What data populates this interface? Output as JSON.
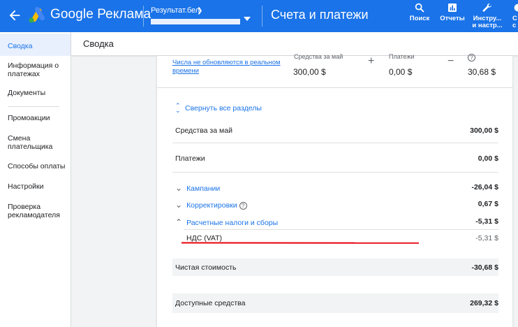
{
  "app": {
    "brand": "Google Реклама",
    "account_name": "Результат.бел",
    "page_heading": "Счета и платежи"
  },
  "toolbar": [
    {
      "label": "Поиск"
    },
    {
      "label": "Отчеты"
    },
    {
      "label_line1": "Инстру...",
      "label_line2": "и настр..."
    },
    {
      "label_line1": "С",
      "label_line2": "с"
    }
  ],
  "sidebar": {
    "items": [
      {
        "label": "Сводка",
        "active": true
      },
      {
        "label": "Информация о платежах"
      },
      {
        "label": "Документы"
      },
      {
        "label": "Промоакции"
      },
      {
        "label": "Смена плательщика"
      },
      {
        "label": "Способы оплаты"
      },
      {
        "label": "Настройки"
      },
      {
        "label": "Проверка рекламодателя"
      }
    ]
  },
  "main": {
    "title": "Сводка",
    "summary": {
      "realtime_note": "Числа не обновляются в реальном времени",
      "col1_label": "Средства за май",
      "col1_value": "300,00 $",
      "col2_label": "Платежи",
      "col2_value": "0,00 $",
      "col3_value": "30,68 $",
      "op_plus": "+",
      "op_minus": "−"
    },
    "collapse_label": "Свернуть все разделы",
    "rows": {
      "funds_label": "Средства за май",
      "funds_value": "300,00 $",
      "payments_label": "Платежи",
      "payments_value": "0,00 $",
      "campaigns_label": "Кампании",
      "campaigns_value": "-26,04 $",
      "adjustments_label": "Корректировки",
      "adjustments_value": "0,67 $",
      "taxes_label": "Расчетные налоги и сборы",
      "taxes_value": "-5,31 $",
      "vat_label": "НДС (VAT)",
      "vat_value": "-5,31 $",
      "net_label": "Чистая стоимость",
      "net_value": "-30,68 $",
      "available_label": "Доступные средства",
      "available_value": "269,32 $"
    }
  },
  "colors": {
    "primary": "#1a73e8",
    "annotation": "#e8000b"
  }
}
